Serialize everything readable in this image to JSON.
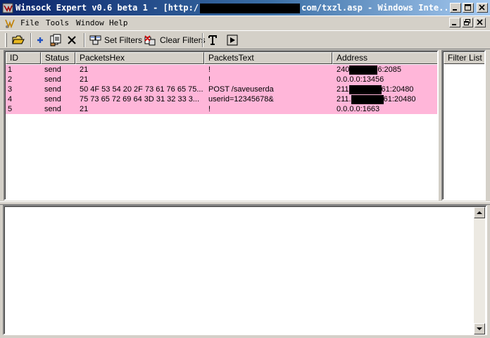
{
  "window": {
    "title_prefix": "Winsock Expert v0.6 beta 1 - [http:/",
    "title_suffix": "com/txzl.asp - Windows Inte...",
    "title_bg": "#0a246a"
  },
  "menu": {
    "items": [
      "File",
      "Tools",
      "Window",
      "Help"
    ]
  },
  "toolbar": {
    "set_filters_label": "Set Filters",
    "clear_filters_label": "Clear Filters"
  },
  "packets": {
    "columns": [
      "ID",
      "Status",
      "PacketsHex",
      "PacketsText",
      "Address"
    ],
    "row_color": "#ffb6d9",
    "rows": [
      {
        "id": "1",
        "status": "send",
        "hex": "21",
        "text": "!",
        "addr_prefix": "240",
        "addr_suffix": "6:2085",
        "addr_redacted": true
      },
      {
        "id": "2",
        "status": "send",
        "hex": "21",
        "text": "!",
        "addr_prefix": "0.0.0.0:13456",
        "addr_suffix": "",
        "addr_redacted": false
      },
      {
        "id": "3",
        "status": "send",
        "hex": "50 4F 53 54 20 2F 73 61 76 65 75...",
        "text": "POST /saveuserda",
        "addr_prefix": "211",
        "addr_suffix": "61:20480",
        "addr_redacted": true
      },
      {
        "id": "4",
        "status": "send",
        "hex": "75 73 65 72 69 64 3D 31 32 33 3...",
        "text": "userid=12345678&",
        "addr_prefix": "211.",
        "addr_suffix": "61:20480",
        "addr_redacted": true
      },
      {
        "id": "5",
        "status": "send",
        "hex": "21",
        "text": "!",
        "addr_prefix": "0.0.0.0:1663",
        "addr_suffix": "",
        "addr_redacted": false
      }
    ]
  },
  "filter_list": {
    "header": "Filter List"
  }
}
